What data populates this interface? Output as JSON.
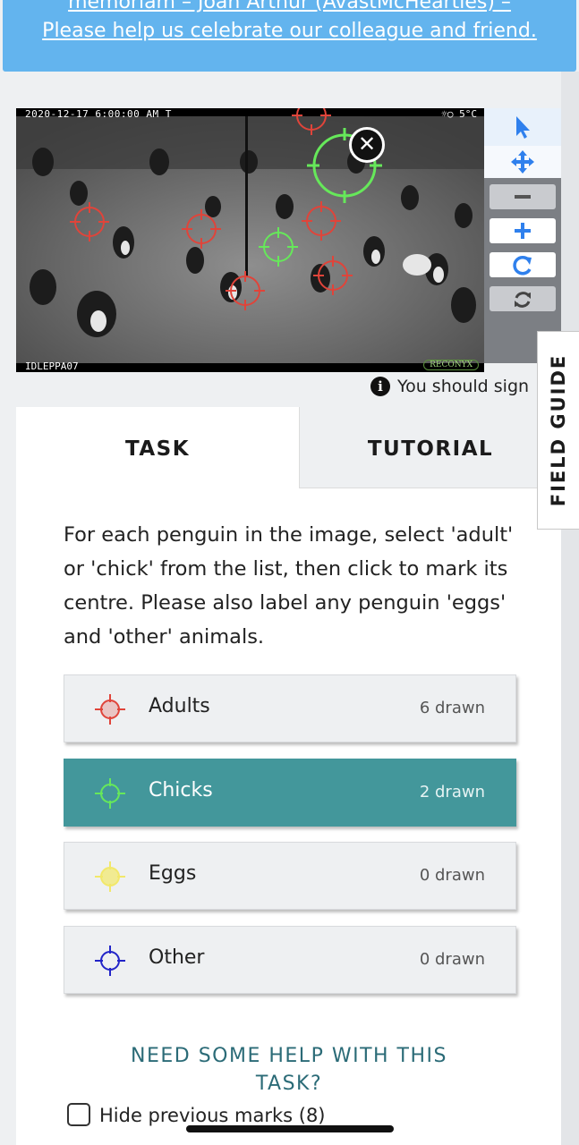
{
  "banner": {
    "line1": "memoriam – Joan Arthur (AvastMcHearties) –",
    "line2": "Please help us celebrate our colleague and friend."
  },
  "camera": {
    "timestamp": "2020-12-17 6:00:00 AM   T",
    "temperature": "☼○  5°C",
    "camera_id": "IDLEPPA07",
    "brand": "RECONYX"
  },
  "toolbar": {
    "tools": [
      {
        "name": "pointer-icon",
        "state": "selected"
      },
      {
        "name": "move-icon",
        "state": "selected"
      },
      {
        "name": "zoom-out-icon",
        "state": "disabled"
      },
      {
        "name": "zoom-in-icon",
        "state": "enabled"
      },
      {
        "name": "rotate-icon",
        "state": "enabled"
      },
      {
        "name": "reset-icon",
        "state": "disabled"
      }
    ]
  },
  "info": {
    "text": "You should sign"
  },
  "tabs": {
    "task": "TASK",
    "tutorial": "TUTORIAL"
  },
  "instructions": "For each penguin in the image, select 'adult' or 'chick' from the list, then click to mark its centre. Please also label any penguin 'eggs' and 'other' animals.",
  "tools": [
    {
      "label": "Adults",
      "count": "6 drawn",
      "color": "#e0443a",
      "active": false
    },
    {
      "label": "Chicks",
      "count": "2 drawn",
      "color": "#66e85a",
      "active": true
    },
    {
      "label": "Eggs",
      "count": "0 drawn",
      "color": "#f2e86a",
      "active": false
    },
    {
      "label": "Other",
      "count": "0 drawn",
      "color": "#2224c8",
      "active": false
    }
  ],
  "help": {
    "line1": "NEED SOME HELP WITH THIS",
    "line2": "TASK?"
  },
  "hide_marks": {
    "label": "Hide previous marks (8)"
  },
  "field_guide": {
    "label": "FIELD GUIDE"
  },
  "colors": {
    "banner": "#63b4ee",
    "active_tool": "#43979b",
    "adult_mark": "#e0443a",
    "chick_mark": "#66e85a",
    "accent_blue": "#2f80ed"
  }
}
